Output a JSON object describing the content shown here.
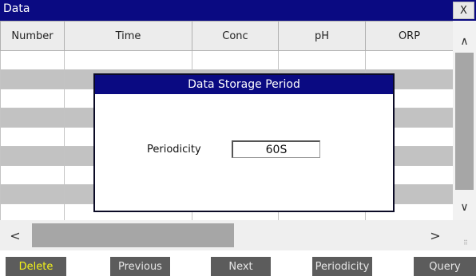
{
  "window": {
    "title": "Data",
    "close_label": "X"
  },
  "table": {
    "columns": [
      "Number",
      "Time",
      "Conc",
      "pH",
      "ORP"
    ],
    "rows": [
      [],
      [],
      [],
      [],
      [],
      [],
      [],
      [],
      []
    ]
  },
  "scroll": {
    "up_glyph": "∧",
    "down_glyph": "∨",
    "left_glyph": "<",
    "right_glyph": ">",
    "grip_glyph": "⠿"
  },
  "dialog": {
    "title": "Data Storage Period",
    "periodicity_label": "Periodicity",
    "periodicity_value": "60S"
  },
  "toolbar": {
    "delete_label": "Delete",
    "previous_label": "Previous",
    "next_label": "Next",
    "periodicity_label": "Periodicity",
    "query_label": "Query"
  },
  "colors": {
    "title_bar": "#0a0a82",
    "button_bg": "#5c5c5c",
    "delete_text": "#f2f21a",
    "row_alt": "#c2c2c2"
  }
}
